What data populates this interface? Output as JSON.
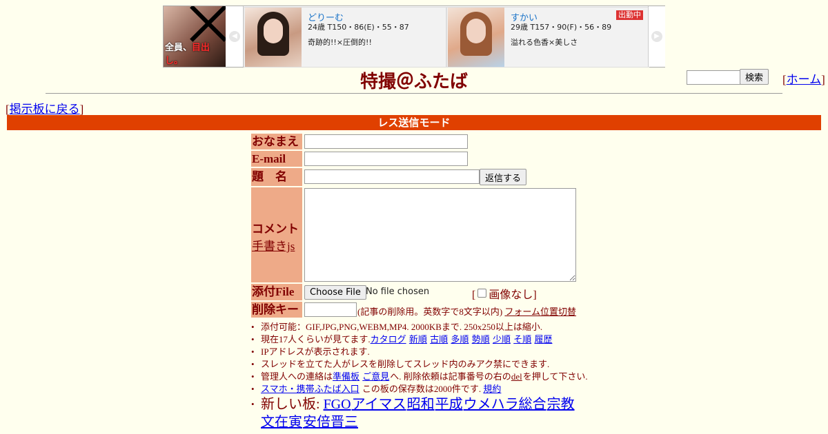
{
  "ad": {
    "logo_text": "全員、",
    "logo_highlight": "目出し。",
    "prev_icon": "chevron-left-icon",
    "next_icon": "chevron-right-icon",
    "cards": [
      {
        "name": "どりーむ",
        "spec": "24歳 T150・86(E)・55・87",
        "catch": "奇跡的!!×圧倒的!!",
        "badge": ""
      },
      {
        "name": "すかい",
        "spec": "29歳 T157・90(F)・56・89",
        "catch": "溢れる色香×美しさ",
        "badge": "出勤中"
      }
    ]
  },
  "header": {
    "title": "特撮＠ふたば",
    "search_button": "検索",
    "home_link": "ホーム",
    "back_link": "掲示板に戻る"
  },
  "mode_bar": "レス送信モード",
  "form": {
    "name_label": "おなまえ",
    "email_label": "E-mail",
    "subject_label": "題　名",
    "submit_button": "返信する",
    "comment_label": "コメント",
    "handwrite_link": "手書きjs",
    "file_label": "添付File",
    "file_button": "Choose File",
    "file_status": "No file chosen",
    "no_image_label": "画像なし",
    "delkey_label": "削除キー",
    "delkey_note": "(記事の削除用。英数字で8文字以内)",
    "form_toggle_link": "フォーム位置切替"
  },
  "notes": {
    "attach": "添付可能：GIF,JPG,PNG,WEBM,MP4. 2000KBまで. 250x250以上は縮小.",
    "viewers_prefix": "現在17人くらいが見てます.",
    "viewers_links": [
      "カタログ",
      "新順",
      "古順",
      "多順",
      "勢順",
      "少順",
      "そ順",
      "履歴"
    ],
    "ip": "IPアドレスが表示されます.",
    "thread_owner": "スレッドを立てた人がレスを削除してスレッド内のみアク禁にできます.",
    "contact_prefix": "管理人への連絡は",
    "contact_link1": "準備板",
    "contact_link2": "ご意見",
    "contact_mid": "へ. 削除依頼は記事番号の右の",
    "contact_del": "del",
    "contact_suffix": "を押して下さい.",
    "mobile_link": "スマホ・携帯ふたば入口",
    "storage": "この板の保存数は2000件です.",
    "rules_link": "規約",
    "new_boards_prefix": "新しい板:",
    "new_boards": [
      "FGO",
      "アイマス",
      "昭和",
      "平成",
      "ウメハラ総合",
      "宗教",
      "文在寅",
      "安倍晋三"
    ]
  }
}
